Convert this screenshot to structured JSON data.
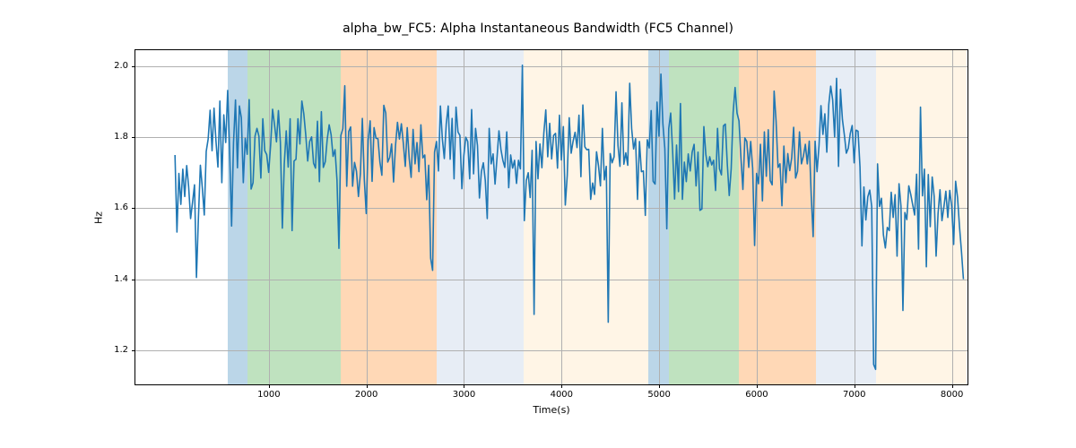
{
  "chart_data": {
    "type": "line",
    "title": "alpha_bw_FC5: Alpha Instantaneous Bandwidth (FC5 Channel)",
    "xlabel": "Time(s)",
    "ylabel": "Hz",
    "xlim": [
      -367.8,
      8159.8
    ],
    "ylim": [
      1.1037,
      2.0453
    ],
    "x_ticks": [
      1000,
      2000,
      3000,
      4000,
      5000,
      6000,
      7000,
      8000
    ],
    "y_ticks": [
      1.2,
      1.4,
      1.6,
      1.8,
      2.0
    ],
    "x_tick_labels": [
      "1000",
      "2000",
      "3000",
      "4000",
      "5000",
      "6000",
      "7000",
      "8000"
    ],
    "y_tick_labels": [
      "1.2",
      "1.4",
      "1.6",
      "1.8",
      "2.0"
    ],
    "line_color": "#1f77b4",
    "bands": [
      {
        "x0": 578,
        "x1": 780,
        "color": "#1f77b4"
      },
      {
        "x0": 780,
        "x1": 1738,
        "color": "#2ca02c"
      },
      {
        "x0": 1738,
        "x1": 2716,
        "color": "#ff7f0e"
      },
      {
        "x0": 2716,
        "x1": 3608,
        "color": "#b0c4de"
      },
      {
        "x0": 3608,
        "x1": 4884,
        "color": "#ffdead"
      },
      {
        "x0": 4884,
        "x1": 5096,
        "color": "#1f77b4"
      },
      {
        "x0": 5096,
        "x1": 5820,
        "color": "#2ca02c"
      },
      {
        "x0": 5820,
        "x1": 6606,
        "color": "#ff7f0e"
      },
      {
        "x0": 6606,
        "x1": 7224,
        "color": "#b0c4de"
      },
      {
        "x0": 7224,
        "x1": 8150,
        "color": "#ffdead"
      }
    ],
    "series": [
      {
        "name": "alpha_bw_FC5",
        "x": [
          38,
          58,
          78,
          98,
          118,
          138,
          158,
          178,
          198,
          218,
          238,
          258,
          278,
          298,
          318,
          338,
          358,
          378,
          398,
          418,
          438,
          458,
          478,
          498,
          518,
          538,
          558,
          578,
          598,
          618,
          638,
          658,
          678,
          698,
          718,
          738,
          758,
          778,
          798,
          818,
          838,
          858,
          878,
          898,
          918,
          938,
          958,
          978,
          998,
          1018,
          1038,
          1058,
          1078,
          1098,
          1118,
          1138,
          1158,
          1178,
          1198,
          1218,
          1238,
          1258,
          1278,
          1298,
          1318,
          1338,
          1358,
          1378,
          1398,
          1418,
          1438,
          1458,
          1478,
          1498,
          1518,
          1538,
          1558,
          1578,
          1598,
          1618,
          1638,
          1658,
          1678,
          1698,
          1718,
          1738,
          1758,
          1778,
          1798,
          1818,
          1838,
          1858,
          1878,
          1898,
          1918,
          1938,
          1958,
          1978,
          1998,
          2018,
          2038,
          2058,
          2078,
          2098,
          2118,
          2138,
          2158,
          2178,
          2198,
          2218,
          2238,
          2258,
          2278,
          2298,
          2318,
          2338,
          2358,
          2378,
          2398,
          2418,
          2438,
          2458,
          2478,
          2498,
          2518,
          2538,
          2558,
          2578,
          2598,
          2618,
          2638,
          2658,
          2678,
          2698,
          2718,
          2738,
          2758,
          2778,
          2798,
          2818,
          2838,
          2858,
          2878,
          2898,
          2918,
          2938,
          2958,
          2978,
          2998,
          3018,
          3038,
          3058,
          3078,
          3098,
          3118,
          3138,
          3158,
          3178,
          3198,
          3218,
          3238,
          3258,
          3278,
          3298,
          3318,
          3338,
          3358,
          3378,
          3398,
          3418,
          3438,
          3458,
          3478,
          3498,
          3518,
          3538,
          3558,
          3578,
          3598,
          3618,
          3638,
          3658,
          3678,
          3698,
          3718,
          3738,
          3758,
          3778,
          3798,
          3818,
          3838,
          3858,
          3878,
          3898,
          3918,
          3938,
          3958,
          3978,
          3998,
          4018,
          4038,
          4058,
          4078,
          4098,
          4118,
          4138,
          4158,
          4178,
          4198,
          4218,
          4238,
          4258,
          4278,
          4298,
          4318,
          4338,
          4358,
          4378,
          4398,
          4418,
          4438,
          4458,
          4478,
          4498,
          4518,
          4538,
          4558,
          4578,
          4598,
          4618,
          4638,
          4658,
          4678,
          4698,
          4718,
          4738,
          4758,
          4778,
          4798,
          4818,
          4838,
          4858,
          4878,
          4898,
          4918,
          4938,
          4958,
          4978,
          4998,
          5018,
          5038,
          5058,
          5078,
          5098,
          5118,
          5138,
          5158,
          5178,
          5198,
          5218,
          5238,
          5258,
          5278,
          5298,
          5318,
          5338,
          5358,
          5378,
          5398,
          5418,
          5438,
          5458,
          5478,
          5498,
          5518,
          5538,
          5558,
          5578,
          5598,
          5618,
          5638,
          5658,
          5678,
          5698,
          5718,
          5738,
          5758,
          5778,
          5798,
          5818,
          5838,
          5858,
          5878,
          5898,
          5918,
          5938,
          5958,
          5978,
          5998,
          6018,
          6038,
          6058,
          6078,
          6098,
          6118,
          6138,
          6158,
          6178,
          6198,
          6218,
          6238,
          6258,
          6278,
          6298,
          6318,
          6338,
          6358,
          6378,
          6398,
          6418,
          6438,
          6458,
          6478,
          6498,
          6518,
          6538,
          6558,
          6578,
          6598,
          6618,
          6638,
          6658,
          6678,
          6698,
          6718,
          6738,
          6758,
          6778,
          6798,
          6818,
          6838,
          6858,
          6878,
          6898,
          6918,
          6938,
          6958,
          6978,
          6998,
          7018,
          7038,
          7058,
          7078,
          7098,
          7118,
          7138,
          7158,
          7178,
          7198,
          7218,
          7238,
          7258,
          7278,
          7298,
          7318,
          7338,
          7358,
          7378,
          7398,
          7418,
          7438,
          7458,
          7478,
          7498,
          7518,
          7538,
          7558,
          7578,
          7598,
          7618,
          7638,
          7658,
          7678,
          7698,
          7718,
          7738,
          7758,
          7778,
          7798,
          7818,
          7838,
          7858,
          7878,
          7898,
          7918,
          7938,
          7958,
          7978,
          7998,
          8018,
          8038,
          8058,
          8078,
          8098,
          8118,
          8138
        ],
        "y": [
          1.75,
          1.533,
          1.698,
          1.611,
          1.71,
          1.633,
          1.72,
          1.66,
          1.571,
          1.617,
          1.666,
          1.405,
          1.573,
          1.721,
          1.658,
          1.581,
          1.76,
          1.795,
          1.876,
          1.762,
          1.882,
          1.789,
          1.716,
          1.902,
          1.672,
          1.863,
          1.785,
          1.932,
          1.762,
          1.55,
          1.785,
          1.905,
          1.714,
          1.888,
          1.855,
          1.672,
          1.797,
          1.752,
          1.906,
          1.654,
          1.672,
          1.803,
          1.825,
          1.803,
          1.685,
          1.852,
          1.762,
          1.751,
          1.701,
          1.778,
          1.879,
          1.835,
          1.787,
          1.875,
          1.786,
          1.544,
          1.725,
          1.818,
          1.716,
          1.852,
          1.537,
          1.733,
          1.738,
          1.852,
          1.781,
          1.902,
          1.866,
          1.807,
          1.733,
          1.788,
          1.801,
          1.727,
          1.713,
          1.845,
          1.675,
          1.872,
          1.715,
          1.731,
          1.794,
          1.835,
          1.807,
          1.746,
          1.765,
          1.68,
          1.487,
          1.805,
          1.824,
          1.945,
          1.662,
          1.816,
          1.829,
          1.662,
          1.729,
          1.704,
          1.633,
          1.697,
          1.853,
          1.681,
          1.585,
          1.792,
          1.846,
          1.676,
          1.827,
          1.797,
          1.796,
          1.73,
          1.693,
          1.89,
          1.868,
          1.73,
          1.743,
          1.781,
          1.674,
          1.777,
          1.842,
          1.795,
          1.838,
          1.783,
          1.718,
          1.827,
          1.741,
          1.687,
          1.822,
          1.725,
          1.785,
          1.703,
          1.835,
          1.742,
          1.75,
          1.624,
          1.721,
          1.459,
          1.425,
          1.758,
          1.788,
          1.705,
          1.888,
          1.795,
          1.74,
          1.838,
          1.888,
          1.738,
          1.853,
          1.683,
          1.885,
          1.815,
          1.805,
          1.655,
          1.748,
          1.8,
          1.788,
          1.683,
          1.878,
          1.697,
          1.825,
          1.777,
          1.629,
          1.703,
          1.728,
          1.678,
          1.571,
          1.825,
          1.725,
          1.753,
          1.668,
          1.742,
          1.818,
          1.766,
          1.735,
          1.715,
          1.815,
          1.658,
          1.75,
          1.713,
          1.735,
          1.67,
          1.735,
          1.711,
          2.003,
          1.565,
          1.678,
          1.7,
          1.63,
          1.763,
          1.301,
          1.788,
          1.683,
          1.781,
          1.714,
          1.812,
          1.877,
          1.745,
          1.839,
          1.739,
          1.805,
          1.811,
          1.713,
          1.862,
          1.736,
          1.83,
          1.609,
          1.693,
          1.855,
          1.755,
          1.789,
          1.814,
          1.771,
          1.862,
          1.689,
          1.891,
          1.773,
          1.765,
          1.766,
          1.625,
          1.671,
          1.639,
          1.759,
          1.72,
          1.663,
          1.825,
          1.68,
          1.718,
          1.279,
          1.754,
          1.728,
          1.745,
          1.928,
          1.776,
          1.718,
          1.897,
          1.724,
          1.756,
          1.721,
          1.952,
          1.824,
          1.767,
          1.796,
          1.625,
          1.788,
          1.703,
          1.705,
          1.58,
          1.793,
          1.77,
          1.875,
          1.676,
          1.668,
          1.899,
          1.803,
          1.978,
          1.838,
          1.768,
          1.542,
          1.824,
          1.868,
          1.76,
          1.626,
          1.778,
          1.647,
          1.895,
          1.625,
          1.73,
          1.675,
          1.753,
          1.705,
          1.758,
          1.78,
          1.663,
          1.758,
          1.594,
          1.598,
          1.83,
          1.752,
          1.717,
          1.745,
          1.722,
          1.735,
          1.65,
          1.825,
          1.711,
          1.694,
          1.832,
          1.837,
          1.725,
          1.636,
          1.711,
          1.87,
          1.94,
          1.868,
          1.846,
          1.742,
          1.653,
          1.798,
          1.788,
          1.715,
          1.788,
          1.713,
          1.495,
          1.698,
          1.669,
          1.78,
          1.621,
          1.815,
          1.69,
          1.821,
          1.678,
          1.666,
          1.93,
          1.846,
          1.715,
          1.725,
          1.607,
          1.775,
          1.672,
          1.754,
          1.706,
          1.741,
          1.828,
          1.685,
          1.704,
          1.815,
          1.725,
          1.747,
          1.78,
          1.725,
          1.789,
          1.637,
          1.52,
          1.789,
          1.703,
          1.776,
          1.889,
          1.808,
          1.866,
          1.758,
          1.892,
          1.944,
          1.905,
          1.801,
          1.966,
          1.718,
          1.935,
          1.85,
          1.806,
          1.755,
          1.769,
          1.81,
          1.833,
          1.728,
          1.82,
          1.817,
          1.716,
          1.494,
          1.66,
          1.567,
          1.632,
          1.651,
          1.605,
          1.16,
          1.146,
          1.725,
          1.605,
          1.628,
          1.525,
          1.488,
          1.546,
          1.537,
          1.645,
          1.574,
          1.638,
          1.465,
          1.669,
          1.606,
          1.312,
          1.588,
          1.568,
          1.663,
          1.639,
          1.61,
          1.581,
          1.696,
          1.485,
          1.885,
          1.635,
          1.71,
          1.435,
          1.695,
          1.548,
          1.688,
          1.634,
          1.465,
          1.585,
          1.652,
          1.565,
          1.604,
          1.648,
          1.574,
          1.65,
          1.605,
          1.498,
          1.676,
          1.63,
          1.547,
          1.478,
          1.4
        ]
      }
    ]
  }
}
